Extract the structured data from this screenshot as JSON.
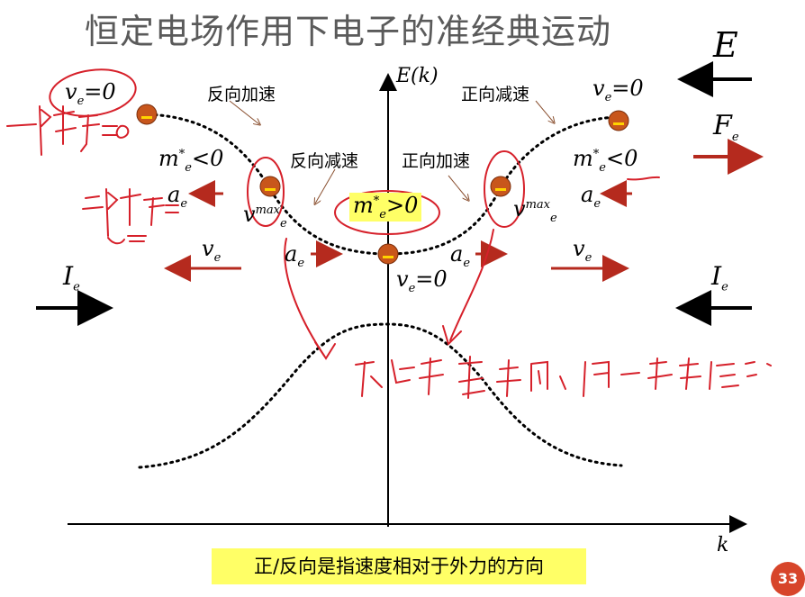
{
  "slide": {
    "title": "恒定电场作用下电子的准经典运动",
    "field_label": "E",
    "page_number": "33"
  },
  "axes": {
    "y_label": "E(k)",
    "x_label": "k"
  },
  "labels": {
    "reverse_accel": "反向加速",
    "forward_decel": "正向减速",
    "reverse_decel": "反向减速",
    "forward_accel": "正向加速",
    "ve_zero_left": "v",
    "ve_zero_right": "v",
    "ve_zero_bottom": "v",
    "mass_neg_left": "m",
    "mass_neg_right": "m",
    "mass_pos_center": "m",
    "a_e": "a",
    "v_e": "v",
    "v_max": "v",
    "I_e": "I",
    "F_e": "F"
  },
  "equations": {
    "eq_zero": "=0",
    "lt_zero": "<0",
    "gt_zero": ">0",
    "sub_e": "e",
    "sup_star": "*",
    "sup_max": "max"
  },
  "banner": "正/反向是指速度相对于外力的方向",
  "electron_minus": "-",
  "colors": {
    "accent_red": "#b52a1e",
    "handwriting_red": "#d6202a",
    "electron_orange": "#c8561c",
    "highlight_yellow": "#ffff66",
    "page_badge": "#d7452a"
  }
}
